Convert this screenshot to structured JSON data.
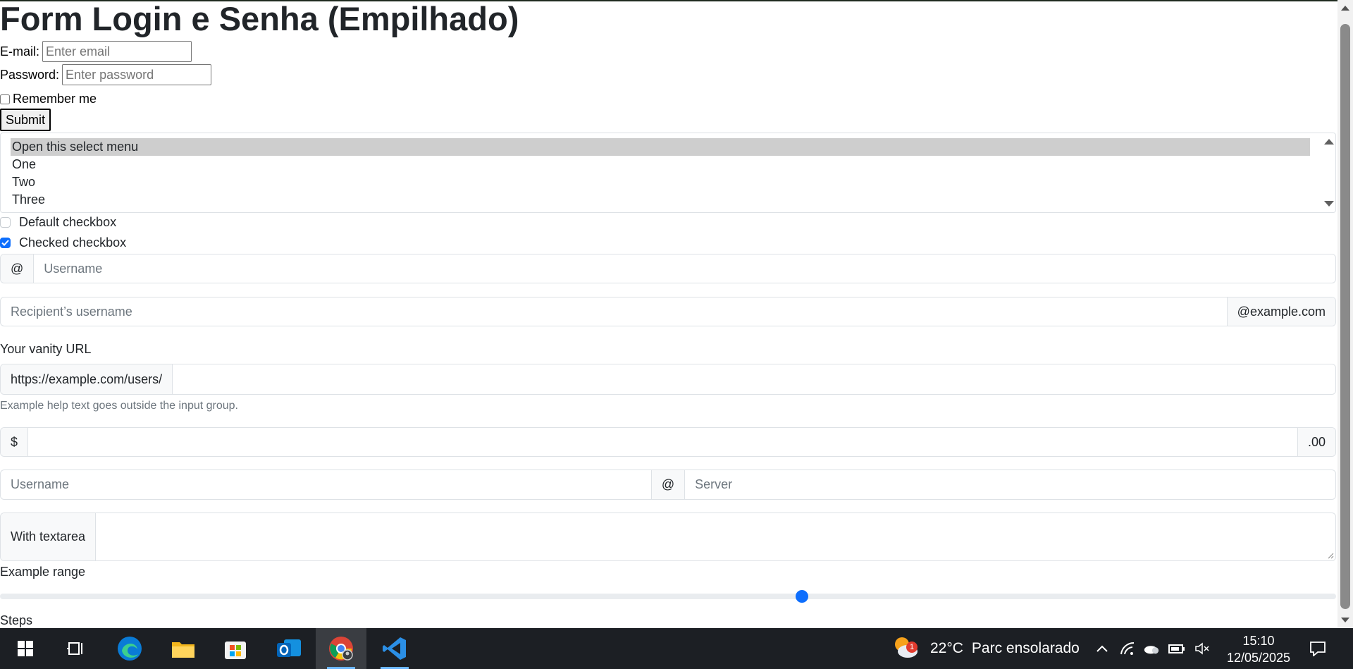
{
  "page": {
    "title": "Form Login e Senha (Empilhado)"
  },
  "login_form": {
    "email_label": "E-mail:",
    "email_placeholder": "Enter email",
    "password_label": "Password:",
    "password_placeholder": "Enter password",
    "remember_label": "Remember me",
    "remember_checked": false,
    "submit_label": "Submit"
  },
  "select_menu": {
    "options": [
      "Open this select menu",
      "One",
      "Two",
      "Three"
    ],
    "selected": "Open this select menu"
  },
  "checkboxes": {
    "default_label": "Default checkbox",
    "default_checked": false,
    "checked_label": "Checked checkbox",
    "checked_checked": true
  },
  "input_groups": {
    "username_prefix": "@",
    "username_placeholder": "Username",
    "recipient_placeholder": "Recipient’s username",
    "recipient_suffix": "@example.com",
    "vanity_label": "Your vanity URL",
    "vanity_prefix": "https://example.com/users/",
    "vanity_help": "Example help text goes outside the input group.",
    "amount_prefix": "$",
    "amount_suffix": ".00",
    "server_username_placeholder": "Username",
    "server_separator": "@",
    "server_placeholder": "Server",
    "textarea_label": "With textarea"
  },
  "range": {
    "label": "Example range",
    "value": 0.6,
    "steps_label": "Steps"
  },
  "taskbar": {
    "apps": [
      "windows-start",
      "task-view",
      "edge",
      "file-explorer",
      "microsoft-store",
      "outlook",
      "chrome",
      "vscode"
    ],
    "active_app": "chrome",
    "weather_temp": "22°C",
    "weather_desc": "Parc ensolarado",
    "weather_badge": "1",
    "time": "15:10",
    "date": "12/05/2025"
  }
}
